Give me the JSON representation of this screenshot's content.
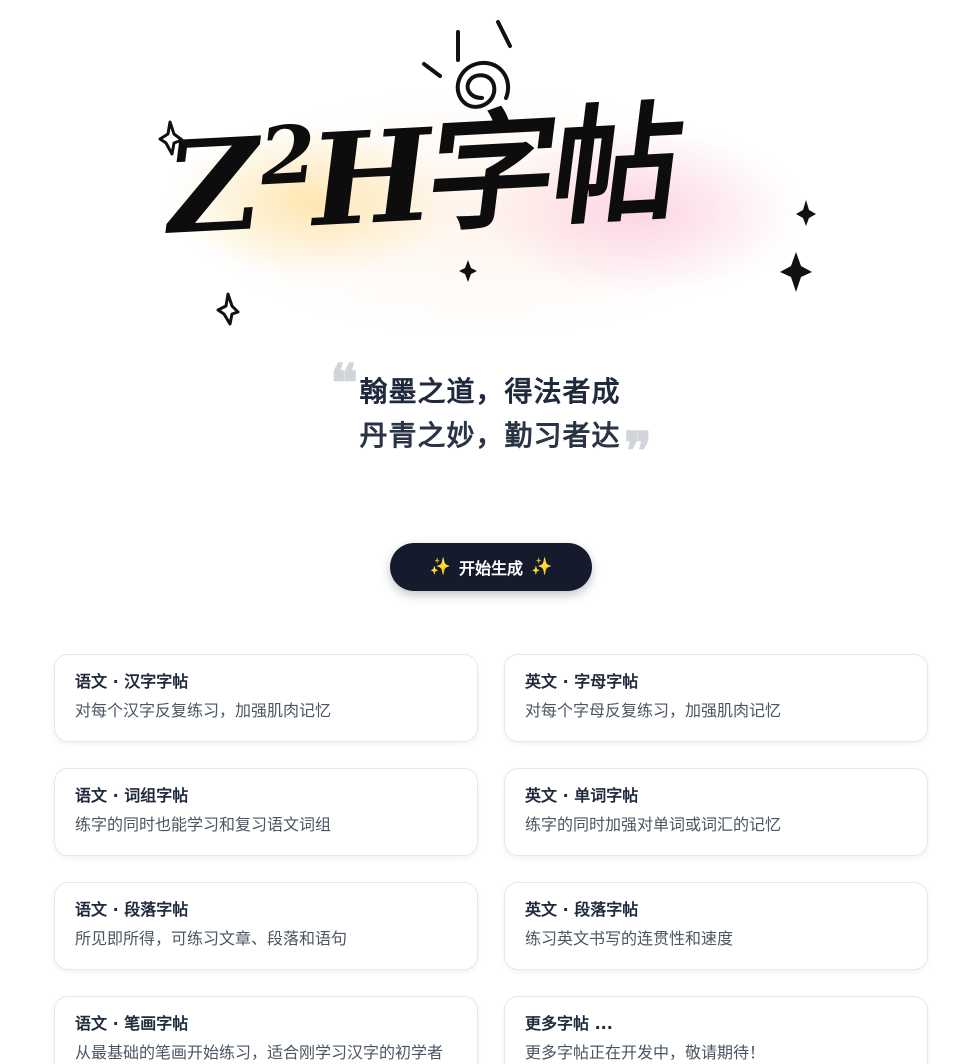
{
  "hero": {
    "title_main": "Z",
    "title_sup": "2",
    "title_rest": "H字帖"
  },
  "quote": {
    "line1": "翰墨之道，得法者成",
    "line2": "丹青之妙，勤习者达",
    "open_mark": "❝",
    "close_mark": "❞"
  },
  "cta": {
    "label": "开始生成",
    "left_icon": "sparkles-icon",
    "right_icon": "sparkles-icon",
    "spark_glyph": "✨"
  },
  "cards": [
    {
      "title": "语文 · 汉字字帖",
      "desc": "对每个汉字反复练习，加强肌肉记忆"
    },
    {
      "title": "英文 · 字母字帖",
      "desc": "对每个字母反复练习，加强肌肉记忆"
    },
    {
      "title": "语文 · 词组字帖",
      "desc": "练字的同时也能学习和复习语文词组"
    },
    {
      "title": "英文 · 单词字帖",
      "desc": "练字的同时加强对单词或词汇的记忆"
    },
    {
      "title": "语文 · 段落字帖",
      "desc": "所见即所得，可练习文章、段落和语句"
    },
    {
      "title": "英文 · 段落字帖",
      "desc": "练习英文书写的连贯性和速度"
    },
    {
      "title": "语文 · 笔画字帖",
      "desc": "从最基础的笔画开始练习，适合刚学习汉字的初学者"
    },
    {
      "title": "更多字帖 ...",
      "desc": "更多字帖正在开发中，敬请期待！"
    }
  ],
  "colors": {
    "cta_background": "#151b2c",
    "spark": "#f8c04a",
    "heading": "#1f2a3d",
    "body_text": "#4b5563"
  }
}
